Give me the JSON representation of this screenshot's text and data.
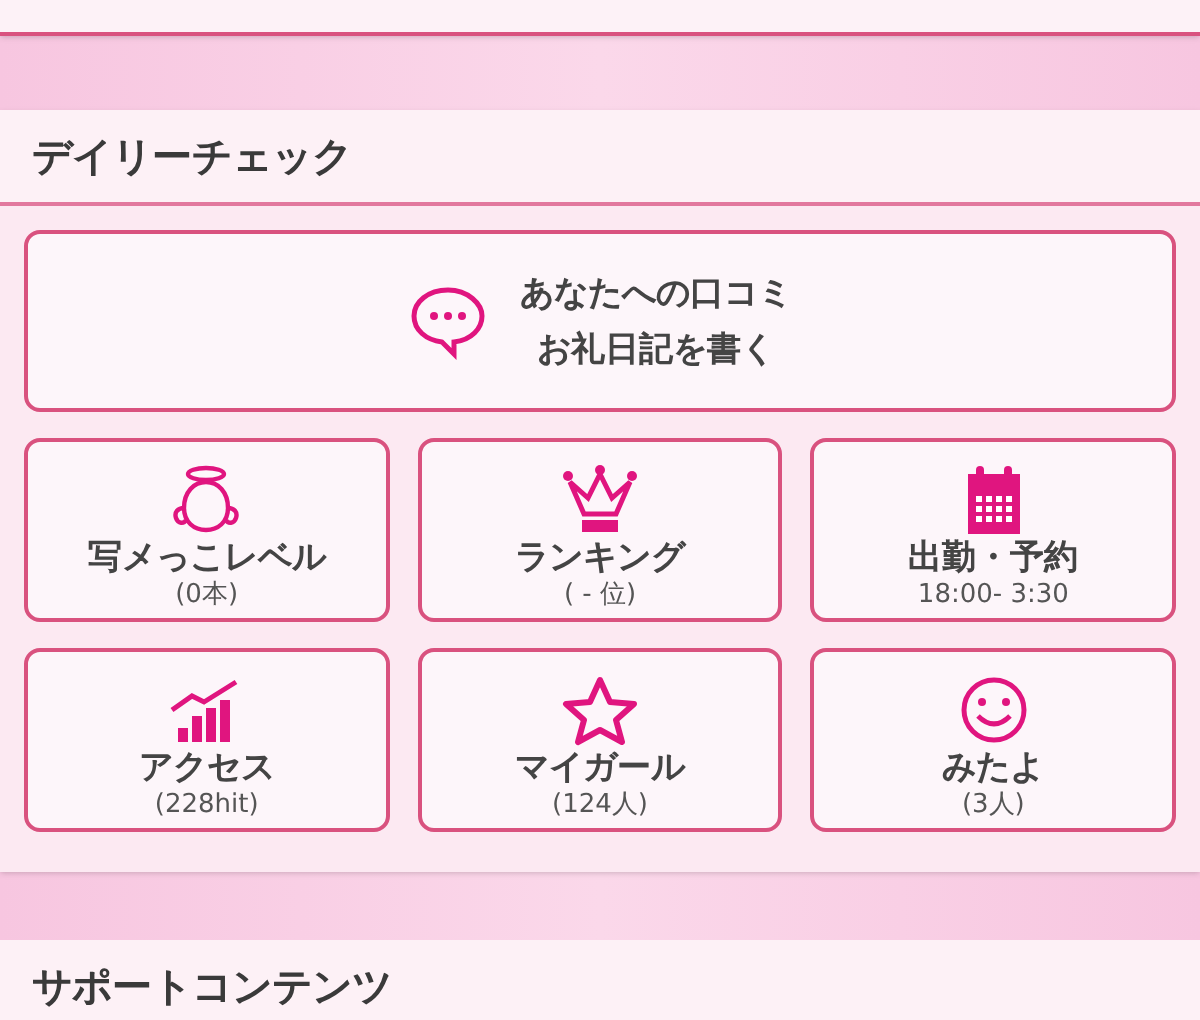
{
  "daily_check": {
    "title": "デイリーチェック",
    "message_button": {
      "lines": [
        "あなたへの口コミ",
        "お礼日記を書く"
      ]
    },
    "tiles": [
      {
        "kind": "angel",
        "label": "写メっこレベル",
        "sub": "(0本)"
      },
      {
        "kind": "crown",
        "label": "ランキング",
        "sub": "( - 位)"
      },
      {
        "kind": "calendar",
        "label": "出勤・予約",
        "sub": "18:00- 3:30"
      },
      {
        "kind": "chart",
        "label": "アクセス",
        "sub": "(228hit)"
      },
      {
        "kind": "star",
        "label": "マイガール",
        "sub": "(124人)"
      },
      {
        "kind": "smile",
        "label": "みたよ",
        "sub": "(3人)"
      }
    ]
  },
  "support": {
    "title": "サポートコンテンツ"
  }
}
